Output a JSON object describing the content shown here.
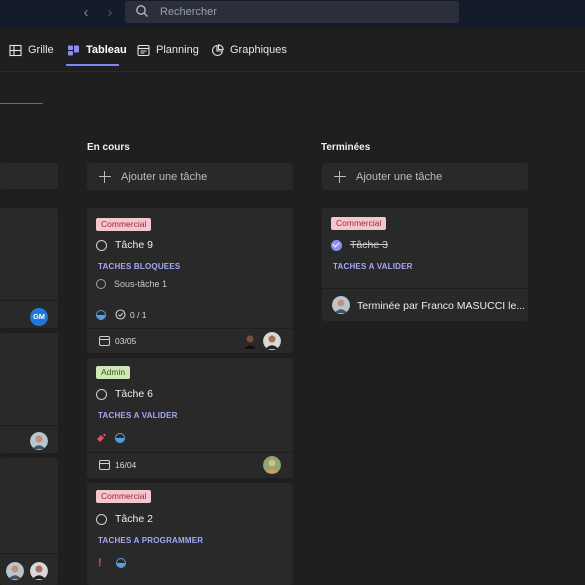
{
  "search": {
    "placeholder": "Rechercher"
  },
  "tabs": [
    {
      "label": "Grille",
      "icon": "grid-icon"
    },
    {
      "label": "Tableau",
      "icon": "board-icon",
      "active": true
    },
    {
      "label": "Planning",
      "icon": "calendar-icon"
    },
    {
      "label": "Graphiques",
      "icon": "chart-icon"
    }
  ],
  "columns": [
    {
      "title": "En cours",
      "add_label": "Ajouter une tâche",
      "cards": [
        {
          "label": "Commercial",
          "task": "Tâche 9",
          "bucket": "TACHES BLOQUEES",
          "subtask": "Sous-tâche 1",
          "checklist": "0 / 1",
          "due": "03/05"
        },
        {
          "label": "Admin",
          "task": "Tâche 6",
          "bucket": "TACHES A VALIDER",
          "due": "16/04"
        },
        {
          "label": "Commercial",
          "task": "Tâche 2",
          "bucket": "TACHES A PROGRAMMER",
          "priority": "!"
        }
      ]
    },
    {
      "title": "Terminées",
      "add_label": "Ajouter une tâche",
      "cards": [
        {
          "label": "Commercial",
          "task": "Tâche 3",
          "bucket": "TACHES A VALIDER",
          "completed_by": "Terminée par Franco MASUCCI le..."
        }
      ]
    }
  ],
  "left_column": {
    "avatar_initials": "GM"
  },
  "colors": {
    "accent": "#7f85f5",
    "label_commercial": "#f3c7cd",
    "label_admin": "#cfe8b8",
    "bucket_text": "#a5a8f7"
  }
}
